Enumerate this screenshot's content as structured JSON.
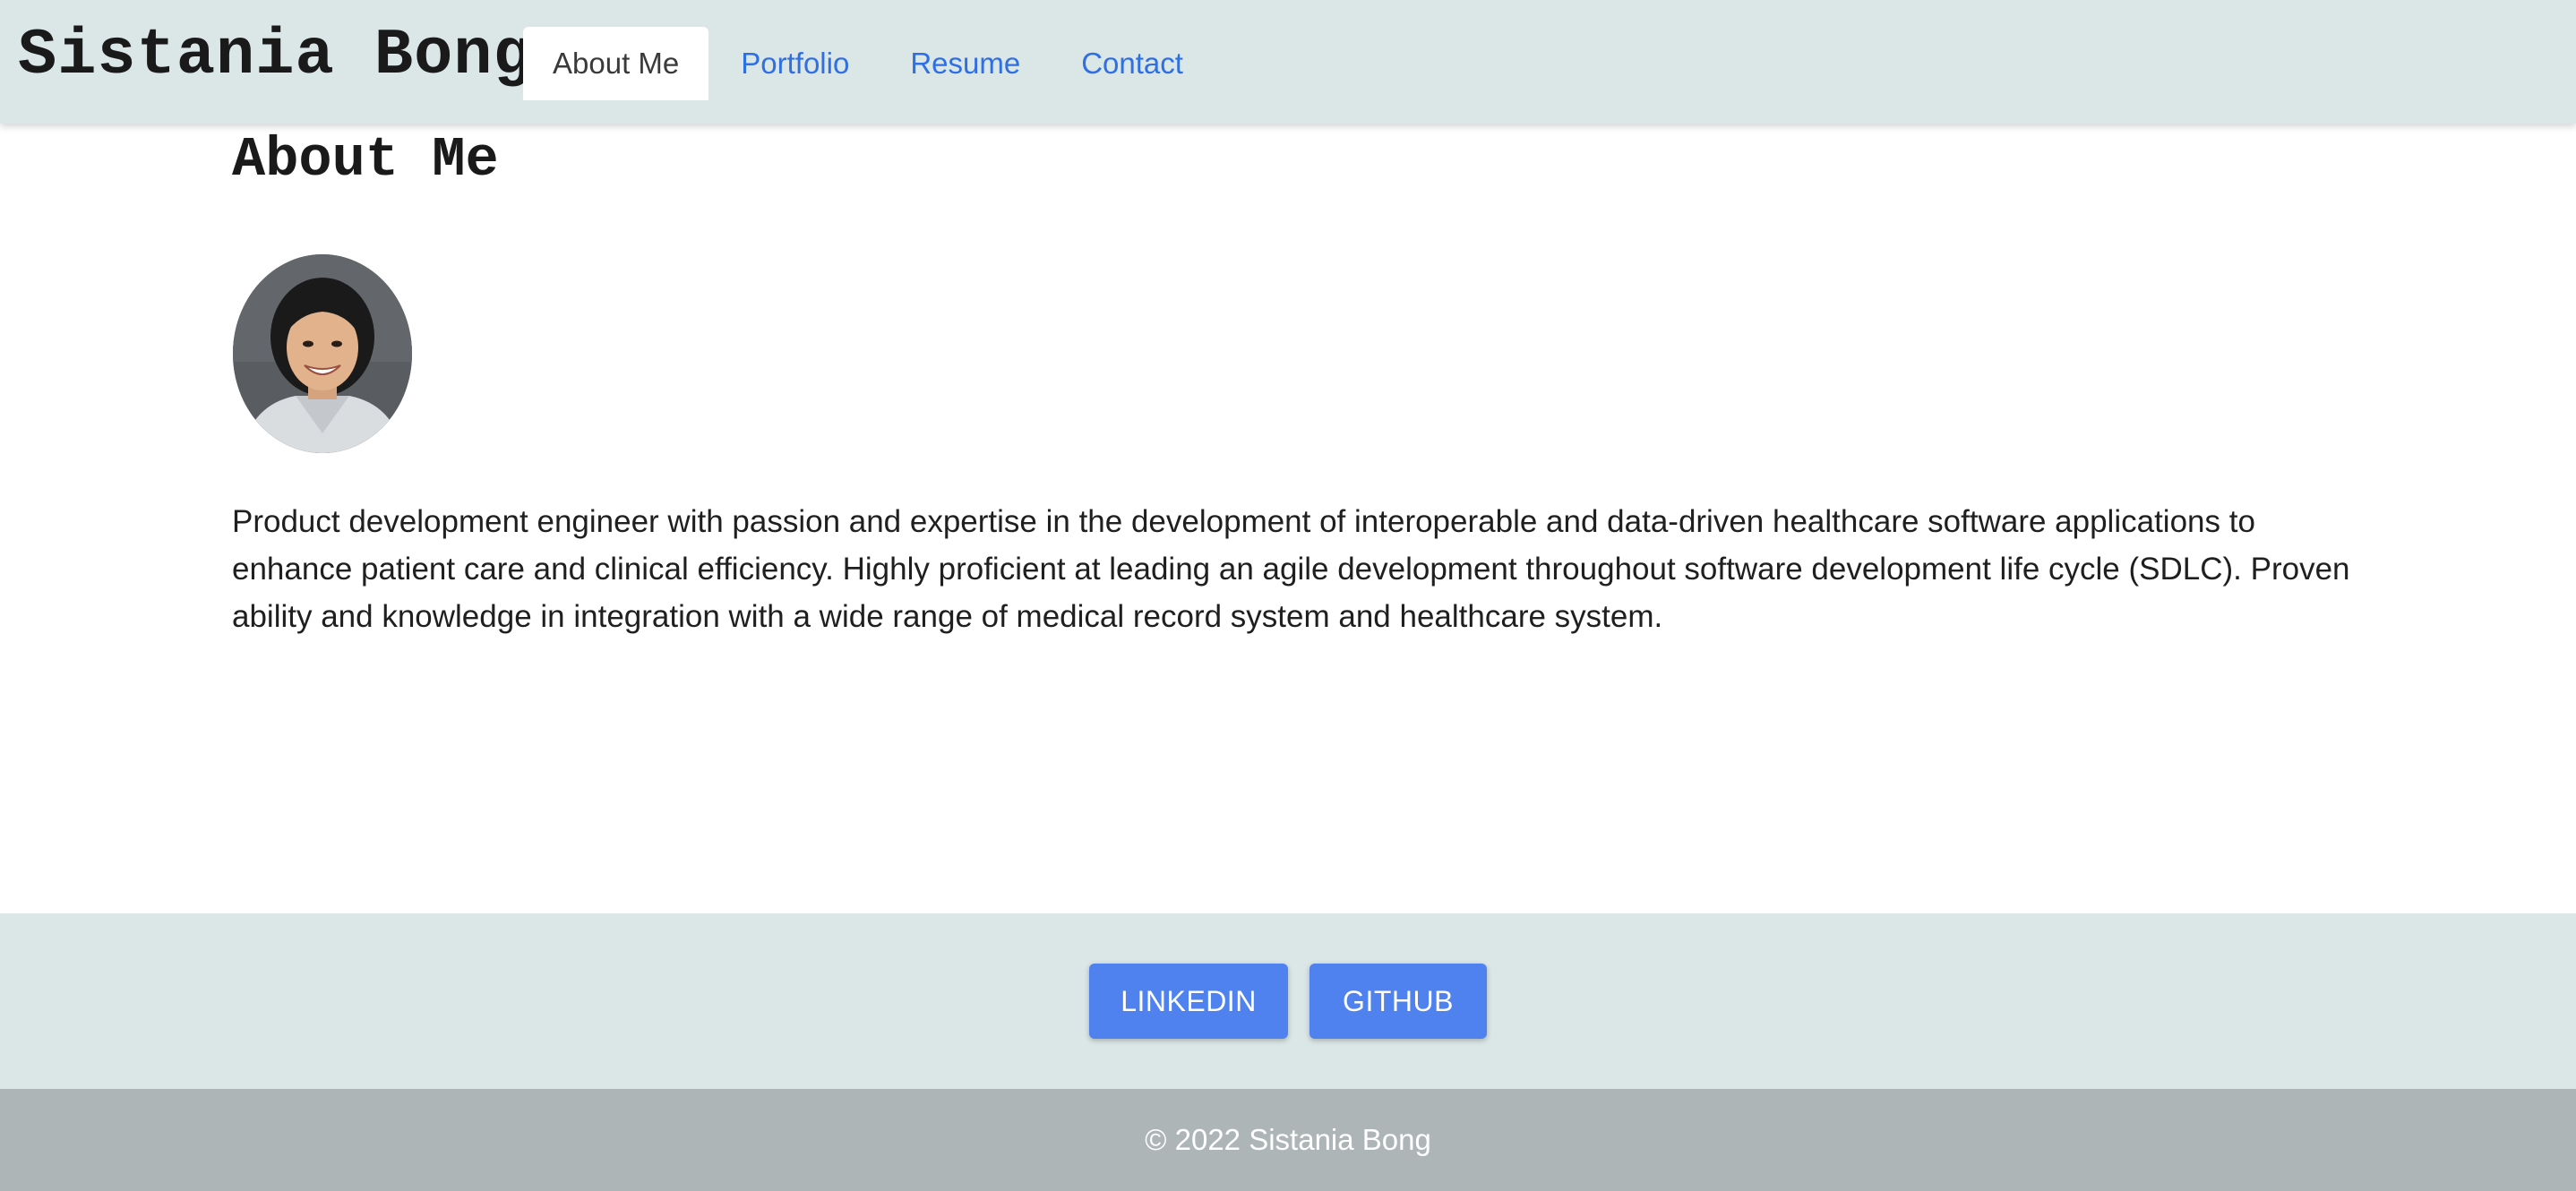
{
  "header": {
    "site_title": "Sistania Bong",
    "nav": [
      {
        "label": "About Me",
        "active": true
      },
      {
        "label": "Portfolio",
        "active": false
      },
      {
        "label": "Resume",
        "active": false
      },
      {
        "label": "Contact",
        "active": false
      }
    ]
  },
  "main": {
    "heading": "About Me",
    "avatar_icon": "profile-photo",
    "bio": "Product development engineer with passion and expertise in the development of interoperable and data-driven healthcare software applications to enhance patient care and clinical efficiency. Highly proficient at leading an agile development throughout software development life cycle (SDLC). Proven ability and knowledge in integration with a wide range of medical record system and healthcare system."
  },
  "footer": {
    "social_buttons": [
      {
        "label": "LINKEDIN"
      },
      {
        "label": "GITHUB"
      }
    ],
    "copyright": "© 2022 Sistania Bong"
  },
  "colors": {
    "header_bg": "#dbe6e7",
    "nav_link": "#2f6fe4",
    "button_bg": "#4f82ee",
    "copyright_bg": "#adb5b6"
  }
}
